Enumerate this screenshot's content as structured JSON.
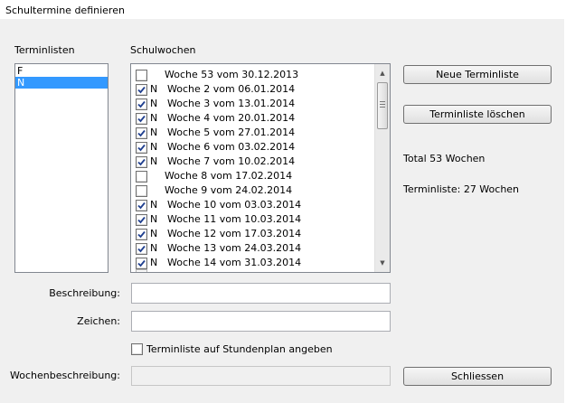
{
  "window": {
    "title": "Schultermine definieren"
  },
  "terminlisten": {
    "label": "Terminlisten",
    "items": [
      {
        "label": "F",
        "selected": false
      },
      {
        "label": "N",
        "selected": true
      }
    ]
  },
  "schulwochen": {
    "label": "Schulwochen",
    "rows": [
      {
        "checked": false,
        "mark": "",
        "text": "Woche 53 vom 30.12.2013"
      },
      {
        "checked": true,
        "mark": "N",
        "text": "Woche 2 vom 06.01.2014"
      },
      {
        "checked": true,
        "mark": "N",
        "text": "Woche 3 vom 13.01.2014"
      },
      {
        "checked": true,
        "mark": "N",
        "text": "Woche 4 vom 20.01.2014"
      },
      {
        "checked": true,
        "mark": "N",
        "text": "Woche 5 vom 27.01.2014"
      },
      {
        "checked": true,
        "mark": "N",
        "text": "Woche 6 vom 03.02.2014"
      },
      {
        "checked": true,
        "mark": "N",
        "text": "Woche 7 vom 10.02.2014"
      },
      {
        "checked": false,
        "mark": "",
        "text": "Woche 8 vom 17.02.2014"
      },
      {
        "checked": false,
        "mark": "",
        "text": "Woche 9 vom 24.02.2014"
      },
      {
        "checked": true,
        "mark": "N",
        "text": "Woche 10 vom 03.03.2014"
      },
      {
        "checked": true,
        "mark": "N",
        "text": "Woche 11 vom 10.03.2014"
      },
      {
        "checked": true,
        "mark": "N",
        "text": "Woche 12 vom 17.03.2014"
      },
      {
        "checked": true,
        "mark": "N",
        "text": "Woche 13 vom 24.03.2014"
      },
      {
        "checked": true,
        "mark": "N",
        "text": "Woche 14 vom 31.03.2014"
      }
    ]
  },
  "buttons": {
    "neue_terminliste": "Neue Terminliste",
    "terminliste_loeschen": "Terminliste löschen",
    "schliessen": "Schliessen"
  },
  "stats": {
    "total": "Total 53 Wochen",
    "terminliste": "Terminliste: 27 Wochen"
  },
  "form": {
    "beschreibung_label": "Beschreibung:",
    "beschreibung_value": "",
    "zeichen_label": "Zeichen:",
    "zeichen_value": "",
    "stundenplan_checkbox_label": "Terminliste auf Stundenplan angeben",
    "stundenplan_checked": false,
    "wochenbeschreibung_label": "Wochenbeschreibung:",
    "wochenbeschreibung_value": ""
  },
  "icons": {
    "scroll_up": "triangle-up-icon",
    "scroll_down": "triangle-down-icon",
    "checkmark": "checkmark-icon"
  },
  "colors": {
    "selection": "#3399ff",
    "check": "#1f3f8f"
  }
}
